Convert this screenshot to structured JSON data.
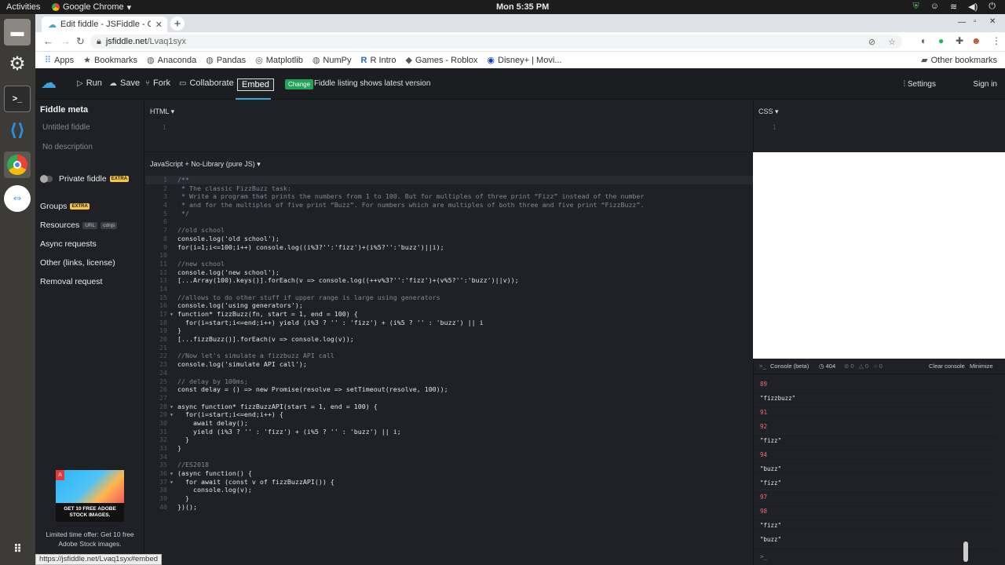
{
  "system": {
    "activities": "Activities",
    "app_name": "Google Chrome",
    "clock": "Mon  5:35 PM"
  },
  "browser": {
    "tab_title": "Edit fiddle - JSFiddle - Cod",
    "url_host": "jsfiddle.net",
    "url_path": "/Lvaq1syx",
    "bookmarks": [
      "Apps",
      "Bookmarks",
      "Anaconda",
      "Pandas",
      "Matplotlib",
      "NumPy",
      "R Intro",
      "Games - Roblox",
      "Disney+ | Movi..."
    ],
    "other_bookmarks": "Other bookmarks",
    "status_url": "https://jsfiddle.net/Lvaq1syx#embed"
  },
  "header": {
    "run": "Run",
    "save": "Save",
    "fork": "Fork",
    "collaborate": "Collaborate",
    "embed": "Embed",
    "change_badge": "Change",
    "change_text": "Fiddle listing shows latest version",
    "settings": "Settings",
    "signin": "Sign in"
  },
  "sidebar": {
    "fiddle_meta": "Fiddle meta",
    "title_placeholder": "Untitled fiddle",
    "desc_placeholder": "No description",
    "private": "Private fiddle",
    "extra": "EXTRA",
    "groups": "Groups",
    "resources": "Resources",
    "url_badge": "URL",
    "cdnjs_badge": "cdnjs",
    "async": "Async requests",
    "other": "Other (links, license)",
    "removal": "Removal request",
    "ad_caption": "GET 10 FREE ADOBE STOCK IMAGES.",
    "ad_text": "Limited time offer: Get 10 free Adobe Stock images."
  },
  "panes": {
    "html_label": "HTML ▾",
    "css_label": "CSS ▾",
    "js_label": "JavaScript + No-Library (pure JS) ▾",
    "html_line": "1",
    "css_line": "1"
  },
  "js_code": [
    "/**",
    " * The classic FizzBuzz task:",
    " * Write a program that prints the numbers from 1 to 100. But for multiples of three print “Fizz” instead of the number",
    " * and for the multiples of five print “Buzz”. For numbers which are multiples of both three and five print “FizzBuzz”.",
    " */",
    "",
    "//old school",
    "console.log('old school');",
    "for(i=1;i<=100;i++) console.log((i%3?'':'fizz')+(i%5?'':'buzz')||i);",
    "",
    "//new school",
    "console.log('new school');",
    "[...Array(100).keys()].forEach(v => console.log((++v%3?'':'fizz')+(v%5?'':'buzz')||v));",
    "",
    "//allows to do other stuff if upper range is large using generators",
    "console.log('using generators');",
    "function* fizzBuzz(fn, start = 1, end = 100) {",
    "  for(i=start;i<=end;i++) yield (i%3 ? '' : 'fizz') + (i%5 ? '' : 'buzz') || i",
    "}",
    "[...fizzBuzz()].forEach(v => console.log(v));",
    "",
    "//Now let's simulate a fizzbuzz API call",
    "console.log('simulate API call');",
    "",
    "// delay by 100ms;",
    "const delay = () => new Promise(resolve => setTimeout(resolve, 100));",
    "",
    "async function* fizzBuzzAPI(start = 1, end = 100) {",
    "  for(i=start;i<=end;i++) {",
    "    await delay();",
    "    yield (i%3 ? '' : 'fizz') + (i%5 ? '' : 'buzz') || i;",
    "  }",
    "}",
    "",
    "//ES2018",
    "(async function() {",
    "  for await (const v of fizzBuzzAPI()) {",
    "    console.log(v);",
    "  }",
    "})();"
  ],
  "console": {
    "title": "Console (beta)",
    "count_404": "404",
    "count_a": "0",
    "count_b": "0",
    "count_c": "0",
    "clear": "Clear console",
    "minimize": "Minimize",
    "prompt": ">_",
    "lines": [
      "89",
      "\"fizzbuzz\"",
      "91",
      "92",
      "\"fizz\"",
      "94",
      "\"buzz\"",
      "\"fizz\"",
      "97",
      "98",
      "\"fizz\"",
      "\"buzz\""
    ]
  }
}
